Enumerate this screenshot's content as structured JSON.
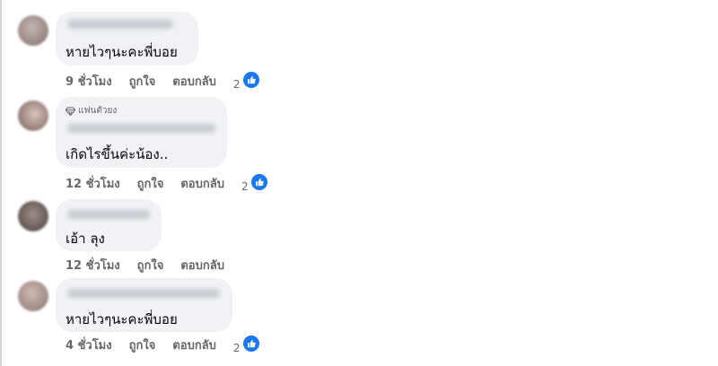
{
  "comments": [
    {
      "text": "หายไวๆนะคะพี่บอย",
      "time": "9 ชั่วโมง",
      "like": "ถูกใจ",
      "reply": "ตอบกลับ",
      "reactions": "2",
      "has_badge": false
    },
    {
      "badge": "แฟนตัวยง",
      "text": "เกิดไรขึ้นค่ะน้อง..",
      "time": "12 ชั่วโมง",
      "like": "ถูกใจ",
      "reply": "ตอบกลับ",
      "reactions": "2",
      "has_badge": true
    },
    {
      "text": "เอ้า ลุง",
      "time": "12 ชั่วโมง",
      "like": "ถูกใจ",
      "reply": "ตอบกลับ",
      "reactions": "",
      "has_badge": false
    },
    {
      "text": "หายไวๆนะคะพี่บอย",
      "time": "4 ชั่วโมง",
      "like": "ถูกใจ",
      "reply": "ตอบกลับ",
      "reactions": "2",
      "has_badge": false
    }
  ],
  "colors": {
    "bubble": "#f0f2f5",
    "meta_text": "#65676b",
    "like_blue": "#1877f2"
  },
  "icons": {
    "reaction": "thumbs-up-icon",
    "badge": "diamond-icon"
  }
}
